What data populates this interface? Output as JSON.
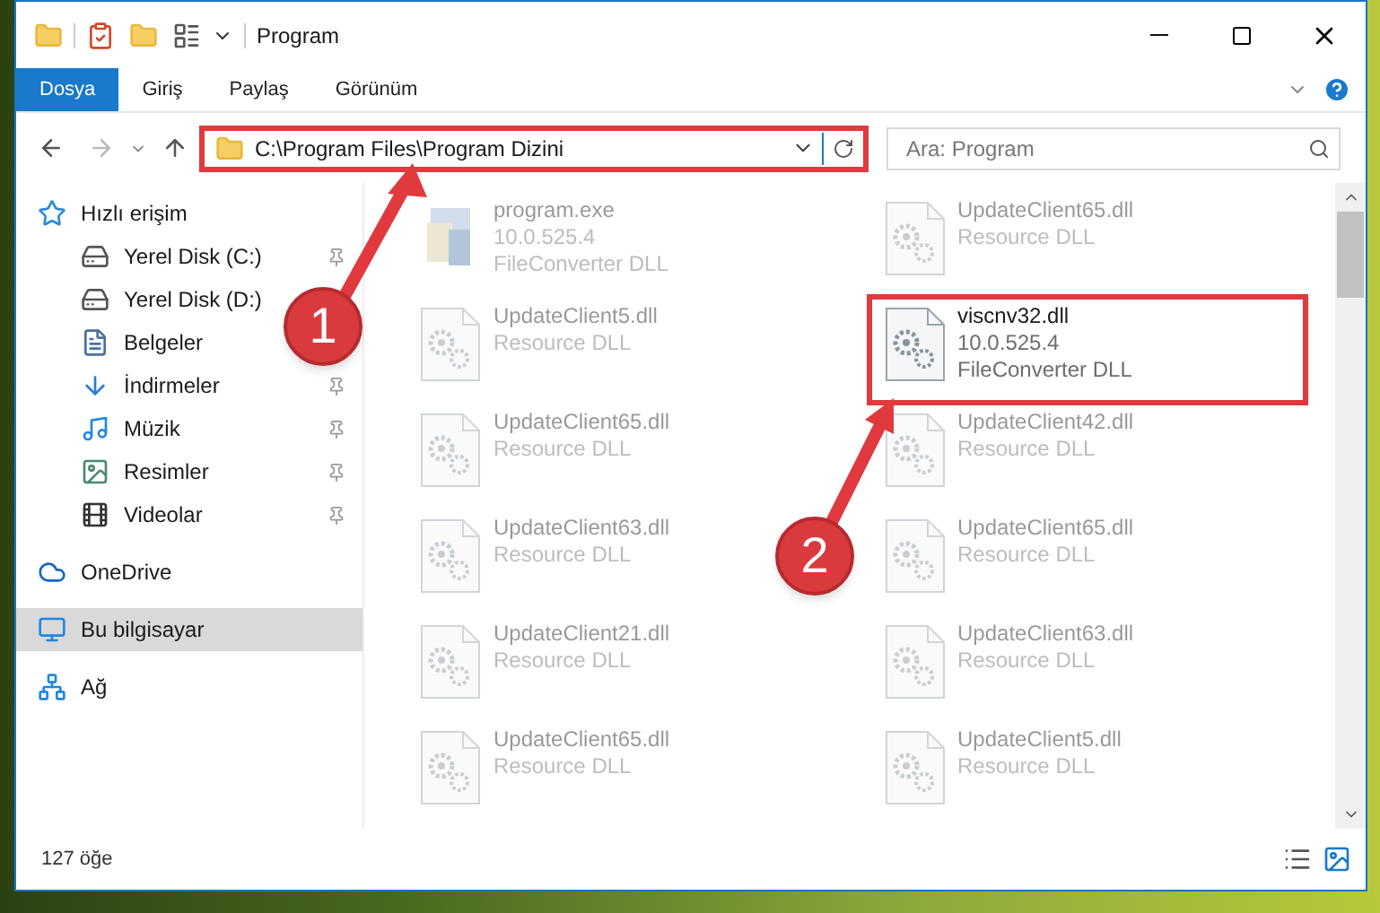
{
  "window": {
    "title": "Program"
  },
  "ribbon_tabs": [
    {
      "label": "Dosya",
      "selected": true
    },
    {
      "label": "Giriş",
      "selected": false
    },
    {
      "label": "Paylaş",
      "selected": false
    },
    {
      "label": "Görünüm",
      "selected": false
    }
  ],
  "address": {
    "path": "C:\\Program Files\\Program Dizini",
    "annotated": true
  },
  "search": {
    "placeholder": "Ara: Program"
  },
  "sidebar": {
    "items": [
      {
        "label": "Hızlı erişim",
        "kind": "quick",
        "selected": false,
        "children": [
          {
            "label": "Yerel Disk (C:)",
            "kind": "disk-c",
            "pinned": true,
            "selected": false
          },
          {
            "label": "Yerel Disk (D:)",
            "kind": "disk",
            "selected": false
          },
          {
            "label": "Belgeler",
            "kind": "docs",
            "selected": false
          },
          {
            "label": "İndirmeler",
            "kind": "downloads",
            "pinned": true,
            "selected": false
          },
          {
            "label": "Müzik",
            "kind": "music",
            "pinned": true,
            "selected": false
          },
          {
            "label": "Resimler",
            "kind": "pictures",
            "pinned": true,
            "selected": false
          },
          {
            "label": "Videolar",
            "kind": "videos",
            "pinned": true,
            "selected": false
          }
        ]
      },
      {
        "label": "OneDrive",
        "kind": "cloud",
        "selected": false
      },
      {
        "label": "Bu bilgisayar",
        "kind": "pc",
        "selected": true
      },
      {
        "label": "Ağ",
        "kind": "network",
        "selected": false
      }
    ]
  },
  "files": [
    {
      "kind": "exe",
      "lines": [
        "program.exe",
        "10.0.525.4",
        "FileConverter DLL"
      ],
      "annotated": false,
      "blurred": true
    },
    {
      "kind": "dll",
      "lines": [
        "UpdateClient65.dll",
        "Resource DLL"
      ],
      "annotated": false,
      "blurred": true
    },
    {
      "kind": "dll",
      "lines": [
        "UpdateClient5.dll",
        "Resource DLL"
      ],
      "annotated": false,
      "blurred": true
    },
    {
      "kind": "dll",
      "lines": [
        "viscnv32.dll",
        "10.0.525.4",
        "FileConverter DLL"
      ],
      "annotated": true,
      "blurred": false
    },
    {
      "kind": "dll",
      "lines": [
        "UpdateClient65.dll",
        "Resource DLL"
      ],
      "annotated": false,
      "blurred": true
    },
    {
      "kind": "dll",
      "lines": [
        "UpdateClient42.dll",
        "Resource DLL"
      ],
      "annotated": false,
      "blurred": true
    },
    {
      "kind": "dll",
      "lines": [
        "UpdateClient63.dll",
        "Resource DLL"
      ],
      "annotated": false,
      "blurred": true
    },
    {
      "kind": "dll",
      "lines": [
        "UpdateClient65.dll",
        "Resource DLL"
      ],
      "annotated": false,
      "blurred": true
    },
    {
      "kind": "dll",
      "lines": [
        "UpdateClient21.dll",
        "Resource DLL"
      ],
      "annotated": false,
      "blurred": true
    },
    {
      "kind": "dll",
      "lines": [
        "UpdateClient63.dll",
        "Resource DLL"
      ],
      "annotated": false,
      "blurred": true
    },
    {
      "kind": "dll",
      "lines": [
        "UpdateClient65.dll",
        "Resource DLL"
      ],
      "annotated": false,
      "blurred": true
    },
    {
      "kind": "dll",
      "lines": [
        "UpdateClient5.dll",
        "Resource DLL"
      ],
      "annotated": false,
      "blurred": true
    }
  ],
  "status_bar": {
    "count": "127 öğe"
  },
  "annotations": [
    {
      "number": "1"
    },
    {
      "number": "2"
    }
  ]
}
